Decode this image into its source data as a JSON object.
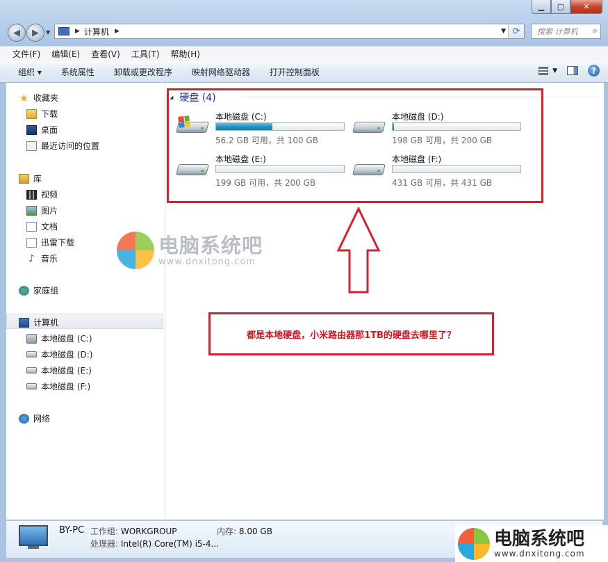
{
  "address": {
    "segment": "计算机",
    "search_placeholder": "搜索 计算机"
  },
  "menu": [
    "文件(F)",
    "编辑(E)",
    "查看(V)",
    "工具(T)",
    "帮助(H)"
  ],
  "toolbar": [
    "组织 ▾",
    "系统属性",
    "卸载或更改程序",
    "映射网络驱动器",
    "打开控制面板"
  ],
  "sidebar": {
    "favorites": "收藏夹",
    "downloads": "下载",
    "desktop": "桌面",
    "recent": "最近访问的位置",
    "libraries": "库",
    "videos": "视频",
    "pictures": "图片",
    "documents": "文档",
    "xunlei": "迅雷下载",
    "music": "音乐",
    "homegroup": "家庭组",
    "computer": "计算机",
    "drives": [
      "本地磁盘 (C:)",
      "本地磁盘 (D:)",
      "本地磁盘 (E:)",
      "本地磁盘 (F:)"
    ],
    "network": "网络"
  },
  "group": {
    "title": "硬盘 (4)"
  },
  "drives": [
    {
      "name": "本地磁盘 (C:)",
      "free_text": "56.2 GB 可用，共 100 GB",
      "used_fraction": 0.438
    },
    {
      "name": "本地磁盘 (D:)",
      "free_text": "198 GB 可用，共 200 GB",
      "used_fraction": 0.01
    },
    {
      "name": "本地磁盘 (E:)",
      "free_text": "199 GB 可用，共 200 GB",
      "used_fraction": 0.0
    },
    {
      "name": "本地磁盘 (F:)",
      "free_text": "431 GB 可用，共 431 GB",
      "used_fraction": 0.0
    }
  ],
  "annotation": {
    "callout": "都是本地硬盘，小米路由器那1TB的硬盘去哪里了？"
  },
  "watermark": {
    "title": "电脑系统吧",
    "url": "www.dnxitong.com"
  },
  "details": {
    "pc_name": "BY-PC",
    "workgroup_label": "工作组:",
    "workgroup": "WORKGROUP",
    "memory_label": "内存:",
    "memory": "8.00 GB",
    "cpu_label": "处理器:",
    "cpu": "Intel(R) Core(TM) i5-4..."
  },
  "colors": {
    "accent_red": "#d71f2e",
    "group_title": "#1e3287",
    "bar_fill": "#2692b9"
  }
}
